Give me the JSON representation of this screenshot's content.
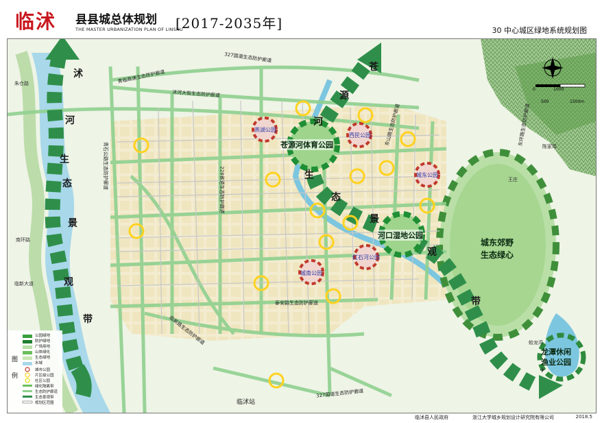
{
  "header": {
    "title_red": "临沭",
    "title_main": "县县城总体规划",
    "title_en": "THE MASTER URBANIZATION PLAN OF LINSHU",
    "title_years": "[2017-2035年]",
    "sheet_title": "30 中心城区绿地系统规划图"
  },
  "footer": {
    "org1": "临沭县人民政府",
    "org2": "浙江大学城乡规划设计研究院有限公司",
    "date": "2018.5"
  },
  "map": {
    "belts": {
      "shu_river": [
        "沭",
        "河",
        "生",
        "态",
        "景",
        "观",
        "带"
      ],
      "cangyuan": [
        "苍",
        "源",
        "河",
        "生",
        "态",
        "景",
        "观",
        "带"
      ]
    },
    "big_parks": {
      "sports_park": "苍源河体育公园",
      "wetland_park": "河口湿地公园",
      "east_suburb_line1": "城东郊野",
      "east_suburb_line2": "生态绿心",
      "longtan_line1": "龙潭休闲",
      "longtan_line2": "渔业公园"
    },
    "city_parks": {
      "yanhu": "燕湖公园",
      "xihu": "西民公园",
      "chengdong": "城东公园",
      "chengnan": "城南公园",
      "hongshi": "红石河公园"
    },
    "corridor_labels": {
      "corr_327_top": "327国道生态防护廊道",
      "corr_lin_left": "青临高速生态防护廊道",
      "corr_shuhe": "沭河大街生态防护廊道",
      "corr_taian": "泰安路生态防护廊道",
      "corr_linxing": "临新路生态防护廊道",
      "corr_327_bottom": "327国道生态防护廊道",
      "corr_qingshi": "青石公路生态防护廊道",
      "corr_228": "228省道生态防护廊道",
      "corr_dongshan": "东山路生态防护廊道",
      "corr_east": "东环路生态防护廊道"
    },
    "place_labels": {
      "linshu_station": "临沭站",
      "yingbin": "双马岗",
      "xiaojiang": "小江流",
      "jiao_long": "蛟龙湾",
      "chen_ji": "陈家埠",
      "wang_zhuang": "王庄",
      "road_linxin": "临新大道",
      "road_nanhuan": "南环路",
      "road_zhuzhai": "朱仓路",
      "road_xihuan": "西环路",
      "road_huangshan": "黄山路"
    },
    "legend": {
      "side_title": [
        "图",
        "例"
      ],
      "items": [
        "公园绿地",
        "防护绿地",
        "广场用地",
        "山体绿化",
        "生态绿地",
        "水域",
        "城市公园",
        "片区级公园",
        "社区公园",
        "绿化隔离带",
        "生态防护廊道",
        "生态景观带",
        "规划区范围"
      ],
      "colors": {
        "park": "#3aa13a",
        "protect": "#1f7f2e",
        "square": "#b7e0a5",
        "mountain": "#6bbf59",
        "eco": "#c9e6b3",
        "water": "#a8d8ea",
        "cityPark": "#c0392b",
        "districtPark": "#ffd21f",
        "communityPark": "#e0e000"
      }
    },
    "scale": {
      "north_symbol": "N",
      "ticks": [
        "0",
        "500",
        "1000",
        "1500m"
      ]
    }
  }
}
